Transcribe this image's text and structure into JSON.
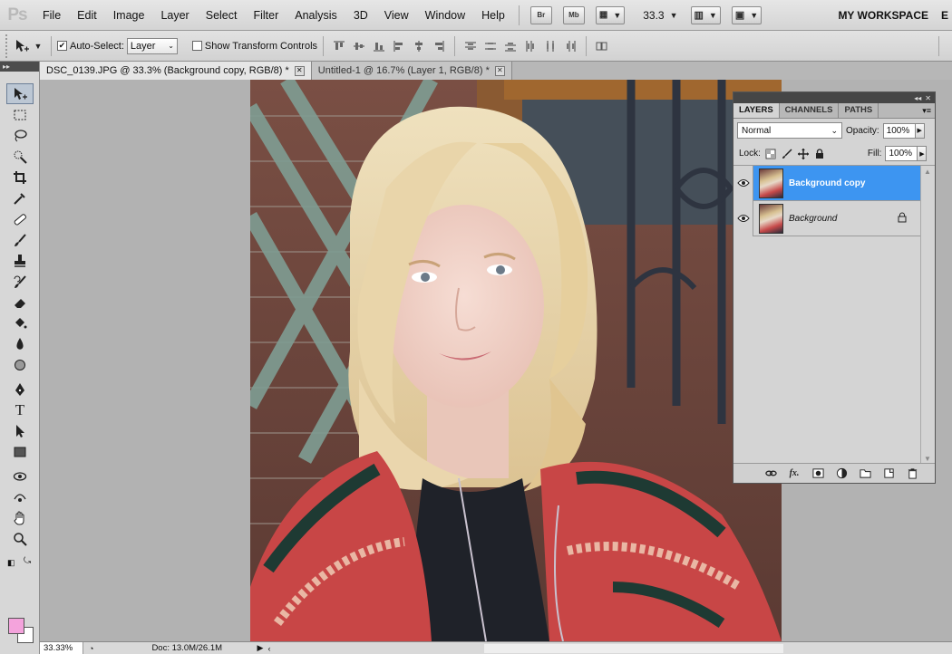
{
  "app": {
    "logo": "Ps"
  },
  "menu": [
    "File",
    "Edit",
    "Image",
    "Layer",
    "Select",
    "Filter",
    "Analysis",
    "3D",
    "View",
    "Window",
    "Help"
  ],
  "menubar_buttons": {
    "bridge": "Br",
    "minibridge": "Mb",
    "zoom": "33.3",
    "workspace": "MY WORKSPACE",
    "workspace_extra": "E"
  },
  "options": {
    "auto_select_label": "Auto-Select:",
    "auto_select_checked": true,
    "auto_select_value": "Layer",
    "transform_label": "Show Transform Controls",
    "transform_checked": false
  },
  "tabs": [
    {
      "label": "DSC_0139.JPG @ 33.3% (Background copy, RGB/8) *",
      "active": true
    },
    {
      "label": "Untitled-1 @ 16.7% (Layer 1, RGB/8) *",
      "active": false
    }
  ],
  "tools": [
    "move-tool-icon",
    "marquee-tool-icon",
    "lasso-tool-icon",
    "quick-select-tool-icon",
    "crop-tool-icon",
    "eyedropper-tool-icon",
    "healing-tool-icon",
    "brush-tool-icon",
    "stamp-tool-icon",
    "history-brush-tool-icon",
    "eraser-tool-icon",
    "paint-bucket-tool-icon",
    "blur-tool-icon",
    "dodge-tool-icon",
    "pen-tool-icon",
    "type-tool-icon",
    "path-select-tool-icon",
    "shape-tool-icon",
    "3d-rotate-tool-icon",
    "3d-orbit-tool-icon",
    "hand-tool-icon",
    "zoom-tool-icon"
  ],
  "colors": {
    "foreground": "#f4a3dc",
    "background": "#ffffff",
    "selection_blue": "#3d95f1"
  },
  "status": {
    "zoom": "33.33%",
    "doc": "Doc: 13.0M/26.1M"
  },
  "layers_panel": {
    "tabs": [
      "LAYERS",
      "CHANNELS",
      "PATHS"
    ],
    "blend_mode": "Normal",
    "opacity_label": "Opacity:",
    "opacity": "100%",
    "lock_label": "Lock:",
    "fill_label": "Fill:",
    "fill": "100%",
    "layers": [
      {
        "name": "Background copy",
        "selected": true,
        "locked": false
      },
      {
        "name": "Background",
        "selected": false,
        "locked": true
      }
    ]
  }
}
